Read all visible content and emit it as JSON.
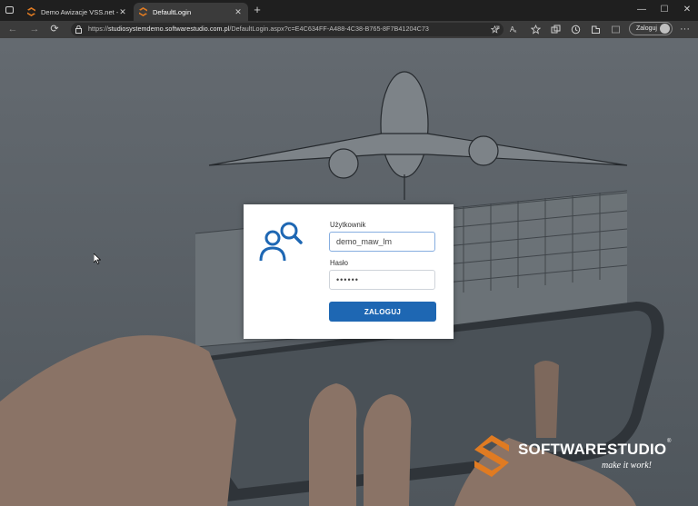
{
  "browser": {
    "tabs": [
      {
        "title": "Demo Awizacje VSS.net - Demo",
        "active": false
      },
      {
        "title": "DefaultLogin",
        "active": true
      }
    ],
    "tab_close": "✕",
    "new_tab": "+",
    "window_controls": {
      "minimize": "—",
      "maximize": "☐",
      "close": "✕"
    },
    "nav": {
      "back": "←",
      "forward": "→",
      "reload": "⟳"
    },
    "url_prefix": "https://",
    "url_host": "studiosystemdemo.softwarestudio.com.pl",
    "url_path": "/DefaultLogin.aspx?c=E4C634FF-A488-4C38-B765-8F7B41204C73",
    "signin_label": "Zaloguj",
    "more": "···",
    "accent": "#e07b22"
  },
  "login": {
    "username_label": "Użytkownik",
    "username_value": "demo_maw_lm",
    "password_label": "Hasło",
    "password_value": "••••••",
    "submit_label": "ZALOGUJ",
    "button_color": "#1e67b3"
  },
  "brand": {
    "name_part1": "SOFTWARE",
    "name_part2": "STUDIO",
    "reg": "®",
    "tagline": "make it work!",
    "logo_color": "#e07b22"
  },
  "icons": [
    "tab-actions-icon",
    "favicon-s-icon",
    "close-icon",
    "plus-icon",
    "back-arrow-icon",
    "forward-arrow-icon",
    "reload-icon",
    "lock-icon",
    "reader-icon",
    "tracking-icon",
    "favorite-icon",
    "collections-icon",
    "history-icon",
    "extensions-icon",
    "share-icon",
    "user-search-icon",
    "mouse-cursor-icon"
  ]
}
